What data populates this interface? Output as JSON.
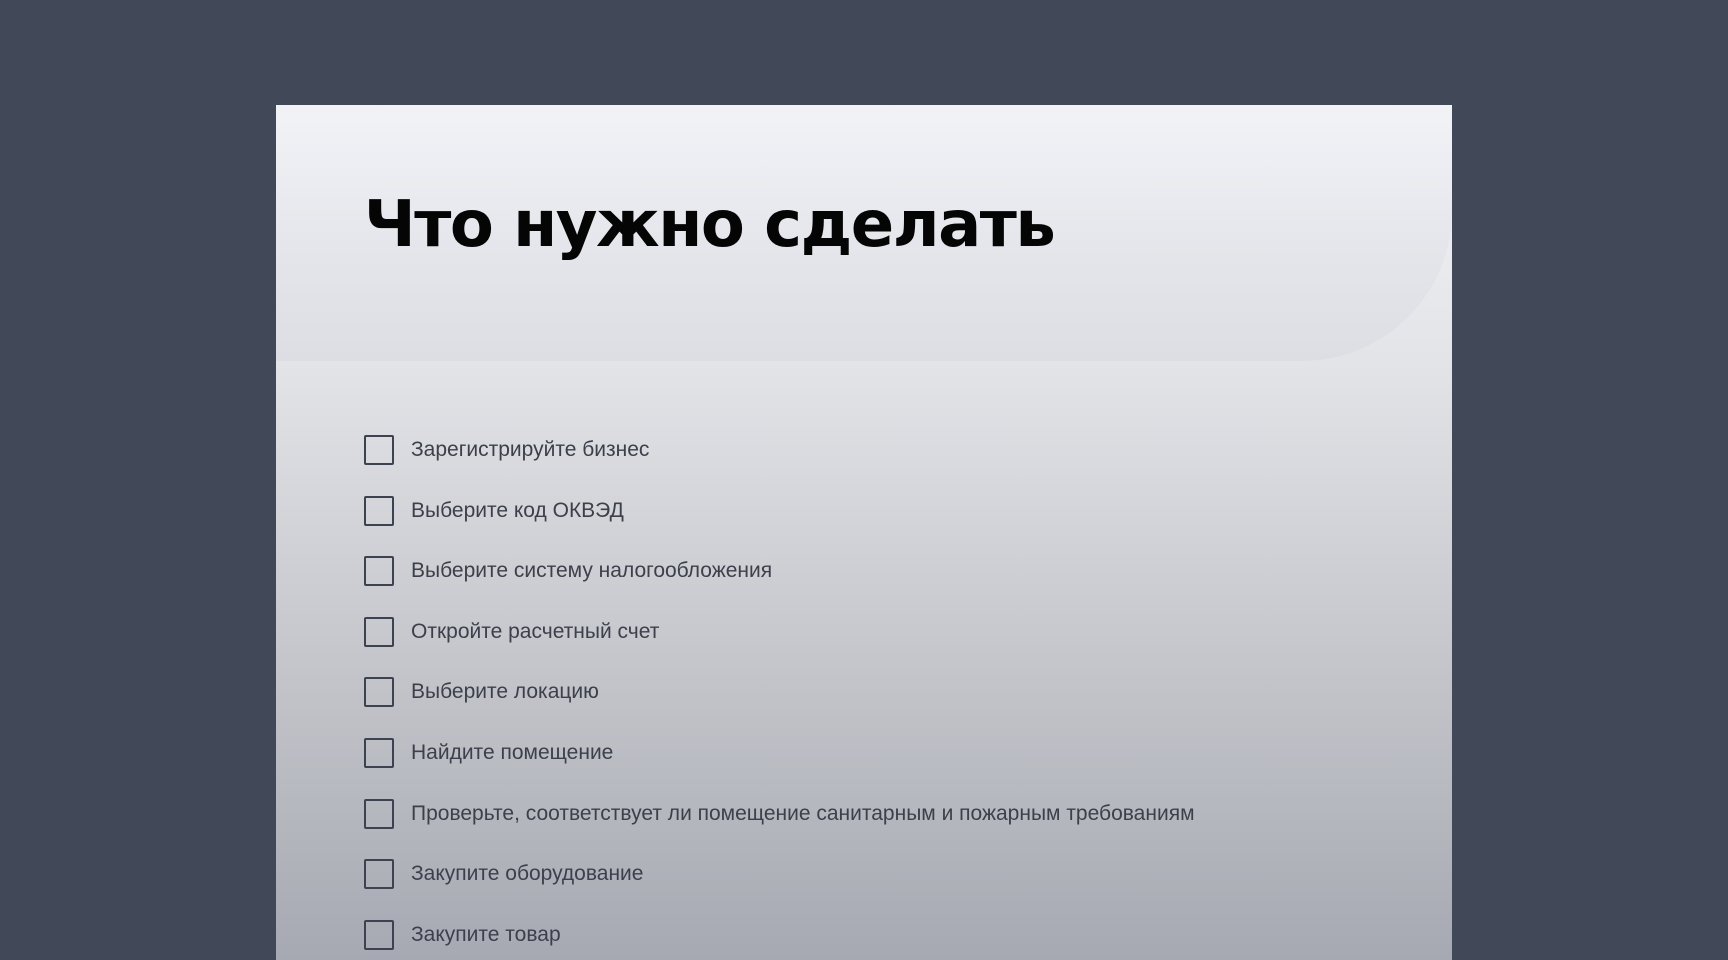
{
  "page": {
    "title": "Что нужно сделать"
  },
  "tasks": [
    {
      "label": "Зарегистрируйте бизнес",
      "checked": false
    },
    {
      "label": "Выберите код ОКВЭД",
      "checked": false
    },
    {
      "label": "Выберите систему налогообложения",
      "checked": false
    },
    {
      "label": "Откройте расчетный счет",
      "checked": false
    },
    {
      "label": "Выберите локацию",
      "checked": false
    },
    {
      "label": "Найдите помещение",
      "checked": false
    },
    {
      "label": "Проверьте, соответствует ли помещение санитарным и пожарным требованиям",
      "checked": false
    },
    {
      "label": "Закупите оборудование",
      "checked": false
    },
    {
      "label": "Закупите товар",
      "checked": false
    }
  ],
  "colors": {
    "page_background": "#414857",
    "title_text": "#050505",
    "task_text": "#3c404b",
    "checkbox_border": "#3d4250"
  }
}
